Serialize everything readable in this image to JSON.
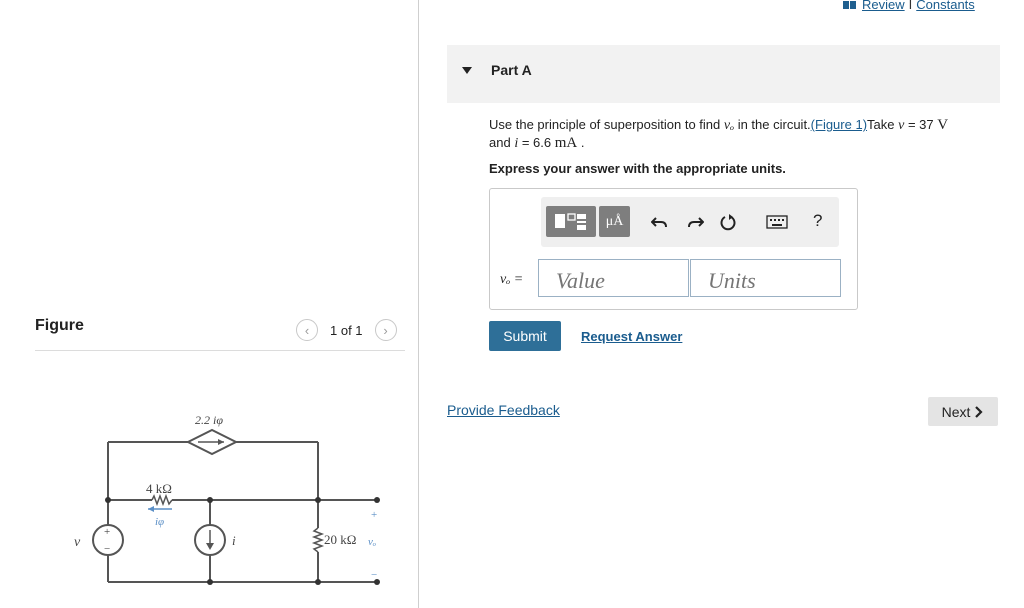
{
  "topnav": {
    "review": "Review",
    "separator": "I",
    "constants": "Constants"
  },
  "figure_panel": {
    "title": "Figure",
    "pager": {
      "prev_icon": "chevron-left-icon",
      "text": "1 of 1",
      "next_icon": "chevron-right-icon"
    },
    "circuit": {
      "dep_source": "2.2 iφ",
      "r1": "4 kΩ",
      "current_label": "iφ",
      "v_source": "v",
      "plus": "+",
      "minus": "−",
      "i_source": "i",
      "r2": "20 kΩ",
      "vo": "vₒ"
    }
  },
  "part": {
    "title": "Part A"
  },
  "question": {
    "text_pre": "Use the principle of superposition to find ",
    "var_vo": "vₒ",
    "text_mid": " in the circuit.",
    "figure_link": "(Figure 1)",
    "text_take": "Take ",
    "var_v": "v",
    "eq_v": " = 37 ",
    "unit_v": "V",
    "text_and": "and ",
    "var_i": "i",
    "eq_i": " = 6.6 ",
    "unit_i": "mA",
    "text_end": " .",
    "instruction": "Express your answer with the appropriate units."
  },
  "answer": {
    "toolbar": {
      "templates_icon": "templates-icon",
      "units_symbol": "μÅ",
      "undo_icon": "undo-icon",
      "redo_icon": "redo-icon",
      "reset_icon": "reset-icon",
      "keyboard_icon": "keyboard-icon",
      "help": "?"
    },
    "label": "vₒ =",
    "value_placeholder": "Value",
    "units_placeholder": "Units"
  },
  "buttons": {
    "submit": "Submit",
    "request_answer": "Request Answer",
    "provide_feedback": "Provide Feedback",
    "next": "Next"
  },
  "colors": {
    "link": "#1a5c8e",
    "submit_bg": "#2e6f98",
    "header_bg": "#f2f2f2",
    "toolbar_btn": "#7e7e7e"
  }
}
